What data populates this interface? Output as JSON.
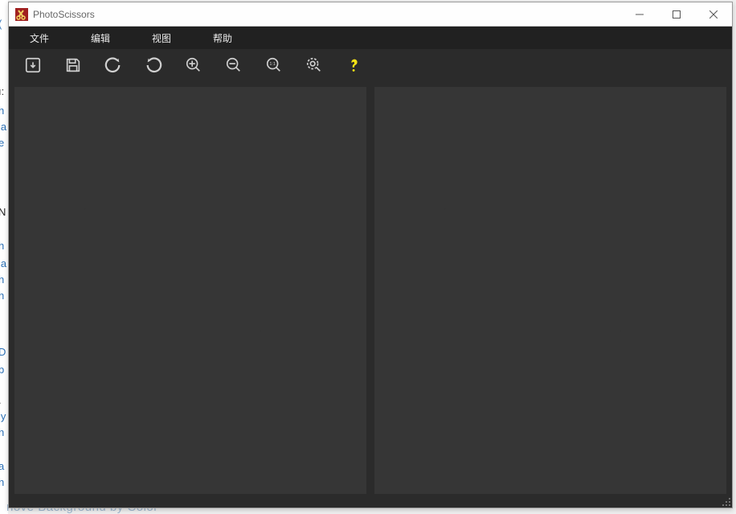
{
  "titlebar": {
    "app_name": "PhotoScissors"
  },
  "menus": {
    "file": "文件",
    "edit": "编辑",
    "view": "视图",
    "help": "帮助"
  },
  "toolbar": {
    "open": "open",
    "save": "save",
    "undo": "undo",
    "redo": "redo",
    "zoom_in": "zoom-in",
    "zoom_out": "zoom-out",
    "zoom_actual": "zoom-1-1",
    "zoom_fit": "zoom-fit",
    "help": "help"
  },
  "bg": {
    "footer": "nove Background by Color"
  }
}
